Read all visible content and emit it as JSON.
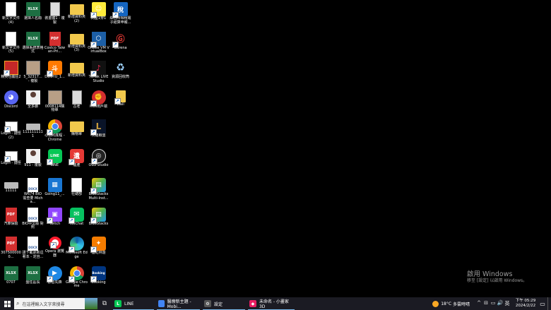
{
  "desktop": {
    "icons": [
      {
        "label": "新文字文件\n(4)",
        "kind": "txt",
        "name": "text-file-icon"
      },
      {
        "label": "新文字文件\n(5)",
        "kind": "txt",
        "name": "text-file-icon"
      },
      {
        "label": "精英也瘋狂2",
        "kind": "mahjong",
        "name": "game-icon",
        "shortcut": true
      },
      {
        "label": "Discord",
        "kind": "discord",
        "name": "discord-icon",
        "glyph": "◕"
      },
      {
        "label": "Login - 捷徑\n(2)",
        "kind": "login",
        "name": "login-shortcut-icon",
        "shortcut": true
      },
      {
        "label": "Login - 捷徑",
        "kind": "login",
        "name": "login-shortcut-icon",
        "shortcut": true
      },
      {
        "label": "11111",
        "kind": "kb",
        "name": "keyboard-icon"
      },
      {
        "label": "汽車保險",
        "kind": "pdf",
        "glyph": "PDF",
        "name": "pdf-file-icon"
      },
      {
        "label": "3075000000...",
        "kind": "pdf",
        "glyph": "PDF",
        "name": "pdf-file-icon"
      },
      {
        "label": "0707",
        "kind": "xlsx",
        "glyph": "XLSX",
        "name": "excel-file-icon"
      },
      {
        "label": "選擇人名冊",
        "kind": "xlsx",
        "glyph": "XLSX",
        "name": "excel-file-icon"
      },
      {
        "label": "選擇系統表格式",
        "kind": "xlsx",
        "glyph": "XLSX",
        "name": "excel-file-icon"
      },
      {
        "label": "5_32317...\n- 複製",
        "kind": "photo",
        "name": "image-file-icon"
      },
      {
        "label": "全多勝",
        "kind": "person",
        "name": "photo-file-icon"
      },
      {
        "label": "1111111111",
        "kind": "kb",
        "name": "keyboard-icon"
      },
      {
        "label": "911 - 複製",
        "kind": "person",
        "name": "photo-file-icon"
      },
      {
        "label": "W674 BIO 需查要 Micha...",
        "kind": "doc",
        "glyph": "DOCX",
        "name": "word-file-icon"
      },
      {
        "label": "BIO中文版 對照",
        "kind": "doc",
        "glyph": "DOCX",
        "name": "word-file-icon"
      },
      {
        "label": "請下載更新這著本 - 定自...",
        "kind": "doc",
        "glyph": "DOCX",
        "name": "word-file-icon"
      },
      {
        "label": "盤任區長",
        "kind": "xlsx",
        "glyph": "XLSX",
        "name": "excel-file-icon"
      },
      {
        "label": "裝置體1 - 複製",
        "kind": "notebook",
        "name": "document-icon"
      },
      {
        "label": "Costco Taiwan-Pri...",
        "kind": "pdf",
        "glyph": "PDF",
        "name": "pdf-file-icon"
      },
      {
        "label": "DOUYU_1...",
        "kind": "douyu",
        "glyph": "斗",
        "name": "douyu-icon",
        "shortcut": true
      },
      {
        "label": "0008114購物單",
        "kind": "photo",
        "name": "image-file-icon"
      },
      {
        "label": "心數的底程 - Chrome",
        "kind": "chrome",
        "name": "chrome-icon",
        "shortcut": true
      },
      {
        "label": "LINE",
        "kind": "line",
        "glyph": "LINE",
        "name": "line-icon",
        "shortcut": true
      },
      {
        "label": "Going11_...",
        "kind": "movie",
        "glyph": "▦",
        "name": "video-file-icon"
      },
      {
        "label": "Twitch",
        "kind": "twitch",
        "glyph": "▣",
        "name": "twitch-icon",
        "shortcut": true
      },
      {
        "label": "Opera 瀏覽器",
        "kind": "opera",
        "name": "opera-icon",
        "shortcut": true
      },
      {
        "label": "影音先鋒",
        "kind": "player",
        "glyph": "▶",
        "name": "media-player-icon",
        "shortcut": true
      },
      {
        "label": "新增資料夾\n(2)",
        "kind": "folder",
        "name": "folder-icon"
      },
      {
        "label": "新增資料夾\n(3)",
        "kind": "folder",
        "name": "folder-icon"
      },
      {
        "label": "新增資料夾",
        "kind": "folder",
        "name": "folder-icon"
      },
      {
        "label": "古老",
        "kind": "notebook",
        "name": "document-icon"
      },
      {
        "label": "購物單",
        "kind": "folder",
        "name": "folder-icon"
      },
      {
        "label": "遺產",
        "kind": "weiwei",
        "glyph": "遺",
        "name": "app-icon",
        "shortcut": true
      },
      {
        "label": "社總部",
        "kind": "txt",
        "name": "text-file-icon"
      },
      {
        "label": "WeChat",
        "kind": "wechat",
        "glyph": "✉",
        "name": "wechat-icon",
        "shortcut": true
      },
      {
        "label": "Microsoft Edge",
        "kind": "edge",
        "name": "edge-icon",
        "shortcut": true
      },
      {
        "label": "Google Chrome",
        "kind": "chrome",
        "name": "chrome-icon",
        "shortcut": true
      },
      {
        "label": "同屋1穿1",
        "kind": "spongebob",
        "glyph": "☺",
        "name": "game-icon",
        "shortcut": true
      },
      {
        "label": "Oracle VM VirtualBox",
        "kind": "vbox",
        "glyph": "⬡",
        "name": "virtualbox-icon",
        "shortcut": true
      },
      {
        "label": "TikTok LIVE Studio",
        "kind": "tiktok",
        "glyph": "♪",
        "name": "tiktok-icon",
        "shortcut": true
      },
      {
        "label": "Riot用戶端",
        "kind": "riot",
        "glyph": "✊",
        "name": "riot-client-icon",
        "shortcut": true
      },
      {
        "label": "英雄聯盟",
        "kind": "lol",
        "glyph": "L",
        "name": "league-of-legends-icon",
        "shortcut": true
      },
      {
        "label": "OBS Studio",
        "kind": "obs",
        "glyph": "◎",
        "name": "obs-icon",
        "shortcut": true
      },
      {
        "label": "BlueStacks Multi-Inst...",
        "kind": "bluestacks",
        "glyph": "▤",
        "name": "bluestacks-multi-icon",
        "shortcut": true
      },
      {
        "label": "BlueStacks",
        "kind": "bluestacks",
        "glyph": "▤",
        "name": "bluestacks-icon",
        "shortcut": true
      },
      {
        "label": "溫虹林遊",
        "kind": "fire",
        "glyph": "✦",
        "name": "game-icon",
        "shortcut": true
      },
      {
        "label": "Booking",
        "kind": "booking",
        "glyph": "Booking",
        "name": "booking-icon",
        "shortcut": true
      },
      {
        "label": "綜合所得稅電子結算申報...",
        "kind": "dev",
        "glyph": "稅",
        "name": "tax-app-icon",
        "shortcut": true
      },
      {
        "label": "Garena",
        "kind": "garena",
        "glyph": "Ⓖ",
        "name": "garena-icon",
        "shortcut": true
      },
      {
        "label": "資源回收筒",
        "kind": "recycle",
        "glyph": "♻",
        "name": "recycle-bin-icon"
      },
      {
        "label": "Wall",
        "kind": "wall",
        "name": "folder-icon",
        "shortcut": true
      }
    ]
  },
  "watermark": {
    "line1": "啟用 Windows",
    "line2": "移至 [設定] 以啟用 Windows。"
  },
  "taskbar": {
    "search_placeholder": "在這裡輸入文字來搜尋",
    "apps": [
      {
        "label": "LINE",
        "icon_kind": "line",
        "icon_glyph": "L",
        "open": true,
        "width": 62
      },
      {
        "label": "醫療新主題 - Mobi...",
        "icon_kind": "chrome",
        "icon_glyph": "",
        "open": true,
        "width": 65
      },
      {
        "label": "設定",
        "icon_kind": "gear",
        "icon_glyph": "⚙",
        "open": true,
        "width": 64
      },
      {
        "label": "未命名 - 小畫家 3D",
        "icon_kind": "paint",
        "icon_glyph": "◆",
        "open": true,
        "width": 70
      }
    ],
    "weather": {
      "temp": "18°C",
      "condition": "多雲時晴"
    },
    "tray_icons": [
      "^",
      "⊟",
      "▭",
      "🔊",
      "英"
    ],
    "clock": {
      "time": "下午 05:29",
      "date": "2024/2/22"
    }
  }
}
